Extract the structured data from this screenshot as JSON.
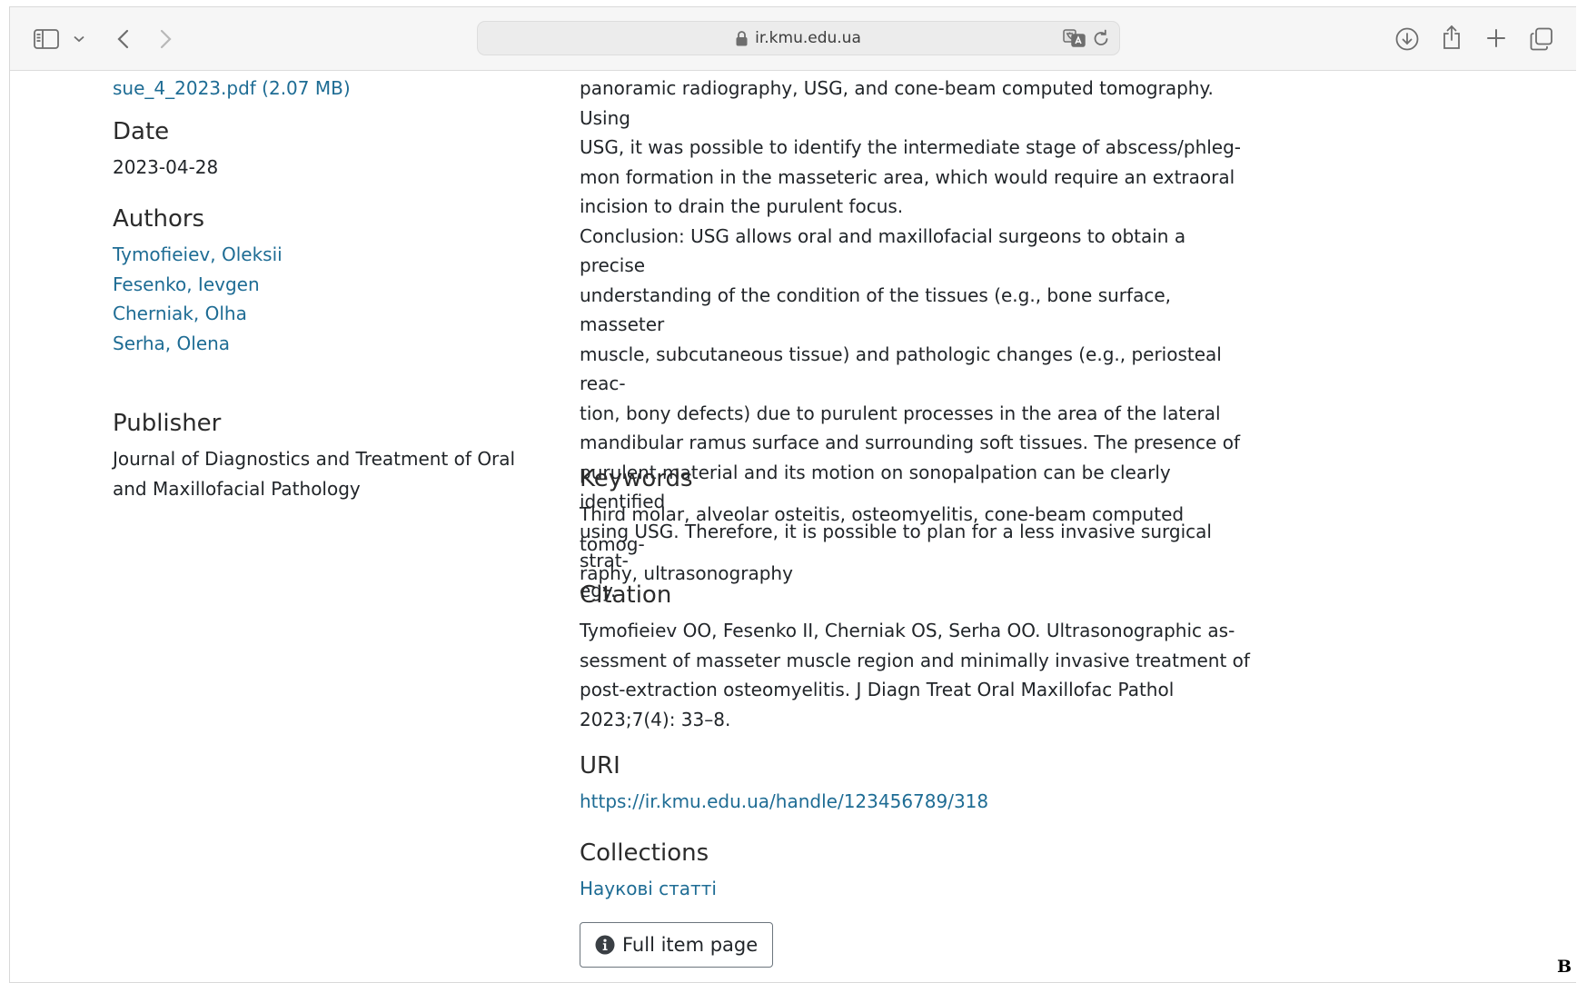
{
  "browser": {
    "url": "ir.kmu.edu.ua",
    "icons": {
      "sidebar": "sidebar-icon",
      "back": "chevron-left-icon",
      "forward": "chevron-right-icon",
      "lock": "lock-icon",
      "translate": "translate-icon",
      "reload": "reload-icon",
      "download": "download-icon",
      "share": "share-icon",
      "new_tab": "plus-icon",
      "tabs": "tabs-overview-icon"
    }
  },
  "left": {
    "file_link_partial": "sue_4_2023.pdf (2.07 MB)",
    "date_heading": "Date",
    "date_value": "2023-04-28",
    "authors_heading": "Authors",
    "authors": [
      "Tymofieiev, Oleksii",
      "Fesenko, Ievgen",
      "Cherniak, Olha",
      "Serha, Olena"
    ],
    "publisher_heading": "Publisher",
    "publisher_lines": [
      "Journal of Diagnostics and Treatment of Oral",
      "and Maxillofacial Pathology"
    ]
  },
  "main": {
    "abstract_lines": [
      "panoramic radiography, USG, and cone-beam computed tomography. Using",
      "USG, it was possible to identify the intermediate stage of abscess/phleg-",
      "mon formation in the masseteric area, which would require an extraoral",
      "incision to drain the purulent focus.",
      "Conclusion: USG allows oral and maxillofacial surgeons to obtain a precise",
      "understanding of the condition of the tissues (e.g., bone surface, masseter",
      "muscle, subcutaneous tissue) and pathologic changes (e.g., periosteal reac-",
      "tion, bony defects) due to purulent processes in the area of the lateral",
      "mandibular ramus surface and surrounding soft tissues. The presence of",
      "purulent material and its motion on sonopalpation can be clearly identified",
      "using USG. Therefore, it is possible to plan for a less invasive surgical strat-",
      "egy."
    ],
    "keywords_heading": "Keywords",
    "keywords_lines": [
      "Third molar, alveolar osteitis, osteomyelitis, cone-beam computed tomog-",
      "raphy, ultrasonography"
    ],
    "citation_heading": "Citation",
    "citation_lines": [
      "Tymofieiev OO, Fesenko II, Cherniak OS, Serha OO. Ultrasonographic as-",
      "sessment of masseter muscle region and minimally invasive treatment of",
      "post-extraction osteomyelitis. J Diagn Treat Oral Maxillofac Pathol",
      "2023;7(4): 33–8."
    ],
    "uri_heading": "URI",
    "uri_link": "https://ir.kmu.edu.ua/handle/123456789/318",
    "collections_heading": "Collections",
    "collections_link": "Наукові статті",
    "full_item_button": "Full item page",
    "full_item_icon": "info-circle-icon"
  },
  "corner_mark": "B",
  "colors": {
    "link": "#1e6c94",
    "text": "#212529",
    "toolbar_bg": "#f6f6f6"
  }
}
